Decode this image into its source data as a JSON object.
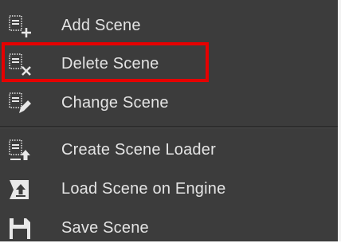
{
  "menu": {
    "items": [
      {
        "label": "Add Scene",
        "icon": "add-scene-icon"
      },
      {
        "label": "Delete Scene",
        "icon": "delete-scene-icon"
      },
      {
        "label": "Change Scene",
        "icon": "change-scene-icon"
      },
      {
        "label": "Create Scene Loader",
        "icon": "create-scene-loader-icon"
      },
      {
        "label": "Load Scene on Engine",
        "icon": "load-scene-on-engine-icon"
      },
      {
        "label": "Save Scene",
        "icon": "save-icon"
      }
    ]
  },
  "highlighted_item": "Delete Scene",
  "colors": {
    "menu_background": "#3c3c3c",
    "text": "#e4e4e4",
    "icon": "#e8e8e8",
    "highlight_border": "#e60000"
  }
}
